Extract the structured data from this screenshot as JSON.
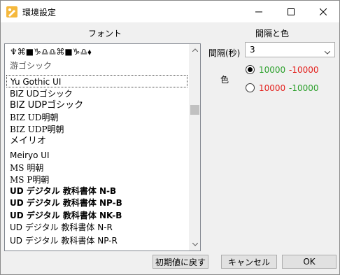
{
  "window": {
    "title": "環境設定",
    "icon": "pencil-palette-icon"
  },
  "font_section": {
    "header": "フォント",
    "items": [
      {
        "label": "♆⌘■♑♎♎⌘■♑♎⬧",
        "weight": "normal"
      },
      {
        "label": "游ゴシック",
        "weight": "normal"
      },
      {
        "label": "Yu Gothic UI",
        "weight": "normal",
        "selected": true
      },
      {
        "label": "BIZ UDゴシック",
        "weight": "normal"
      },
      {
        "label": "BIZ UDPゴシック",
        "weight": "normal"
      },
      {
        "label": "BIZ UD明朝",
        "weight": "normal"
      },
      {
        "label": "BIZ UDP明朝",
        "weight": "normal"
      },
      {
        "label": "メイリオ",
        "weight": "normal"
      },
      {
        "label": "Meiryo UI",
        "weight": "normal"
      },
      {
        "label": "MS 明朝",
        "weight": "normal"
      },
      {
        "label": "MS P明朝",
        "weight": "normal"
      },
      {
        "label": "UD デジタル 教科書体 N-B",
        "weight": "bold"
      },
      {
        "label": "UD デジタル 教科書体 NP-B",
        "weight": "bold"
      },
      {
        "label": "UD デジタル 教科書体 NK-B",
        "weight": "bold"
      },
      {
        "label": "UD デジタル 教科書体 N-R",
        "weight": "normal"
      },
      {
        "label": "UD デジタル 教科書体 NP-R",
        "weight": "normal"
      }
    ]
  },
  "settings": {
    "header": "間隔と色",
    "interval_label": "間隔(秒)",
    "interval_value": "3",
    "color_label": "色",
    "options": [
      {
        "positive": "10000",
        "negative": "-10000",
        "checked": true,
        "positive_color": "#2ca02c",
        "negative_color": "#e3201c"
      },
      {
        "positive": "10000",
        "negative": "-10000",
        "checked": false,
        "positive_color": "#e3201c",
        "negative_color": "#2ca02c"
      }
    ]
  },
  "buttons": {
    "reset": "初期値に戻す",
    "cancel": "キャンセル",
    "ok": "OK"
  }
}
